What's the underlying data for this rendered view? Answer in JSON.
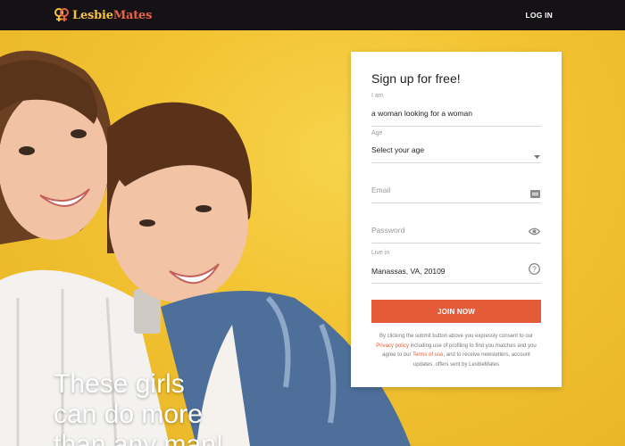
{
  "brand": {
    "name_part1": "Lesbie",
    "name_part2": "Mates",
    "accent": "#e35b39",
    "gold": "#f6c23a"
  },
  "header": {
    "login_label": "LOG IN"
  },
  "hero": {
    "tagline_lines": [
      "These girls",
      "can do more",
      "than any man!"
    ]
  },
  "signup": {
    "title": "Sign up for free!",
    "iam": {
      "label": "I am",
      "value": "a woman looking for a woman"
    },
    "age": {
      "label": "Age",
      "value": "Select your age"
    },
    "email": {
      "placeholder": "Email"
    },
    "password": {
      "placeholder": "Password"
    },
    "location": {
      "label": "Live in",
      "value": "Manassas, VA, 20109"
    },
    "join_label": "JOIN NOW",
    "consent": {
      "part1": "By clicking the submit button above you expressly consent to our",
      "privacy_link": "Privacy policy",
      "part2": "including use of profiling to find you matches and you agree to our",
      "terms_link": "Terms of use",
      "part3": ", and to receive newsletters, account updates, offers sent by LesbieMates"
    }
  },
  "icons": {
    "email": "email-card-icon",
    "password": "eye-icon",
    "location": "question-circle-icon",
    "age": "dropdown-arrow-icon"
  }
}
